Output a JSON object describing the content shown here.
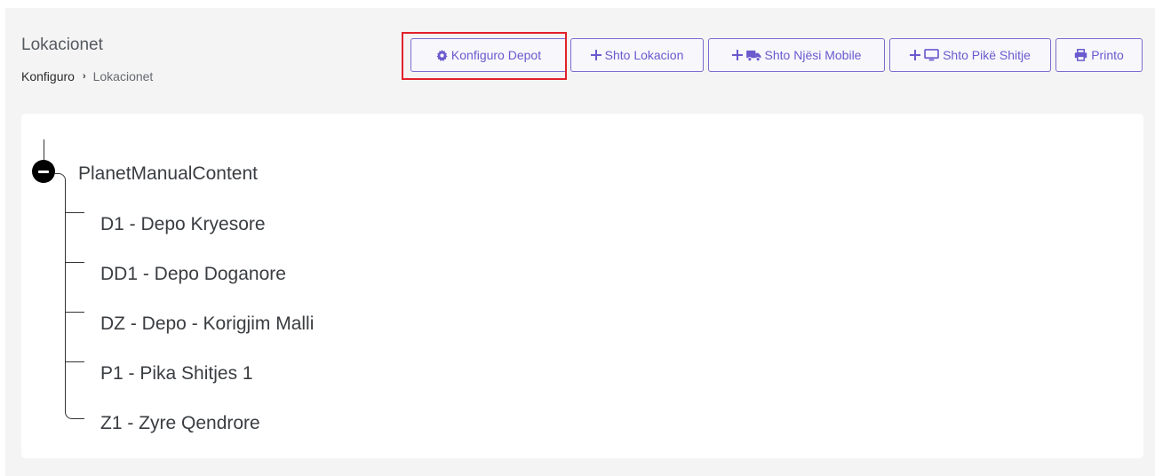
{
  "header": {
    "title": "Lokacionet",
    "breadcrumb": {
      "parent": "Konfiguro",
      "separator": "›",
      "current": "Lokacionet"
    }
  },
  "toolbar": {
    "buttons": [
      {
        "label": "Konfiguro Depot",
        "icon": "gear-icon",
        "highlighted": true
      },
      {
        "label": "Shto Lokacion",
        "icon": "plus-icon"
      },
      {
        "label": "Shto Njësi Mobile",
        "icon": "plus-truck-icon"
      },
      {
        "label": "Shto Pikë Shitje",
        "icon": "plus-monitor-icon"
      },
      {
        "label": "Printo",
        "icon": "printer-icon"
      }
    ]
  },
  "tree": {
    "root": {
      "label": "PlanetManualContent",
      "expanded": true,
      "children": [
        {
          "label": "D1 - Depo Kryesore"
        },
        {
          "label": "DD1 - Depo Doganore"
        },
        {
          "label": "DZ - Depo - Korigjim Malli"
        },
        {
          "label": "P1 - Pika Shitjes 1"
        },
        {
          "label": "Z1 - Zyre Qendrore"
        }
      ]
    }
  },
  "colors": {
    "accent": "#6a5acd",
    "highlight": "#e2212a",
    "background": "#f4f4f4"
  }
}
